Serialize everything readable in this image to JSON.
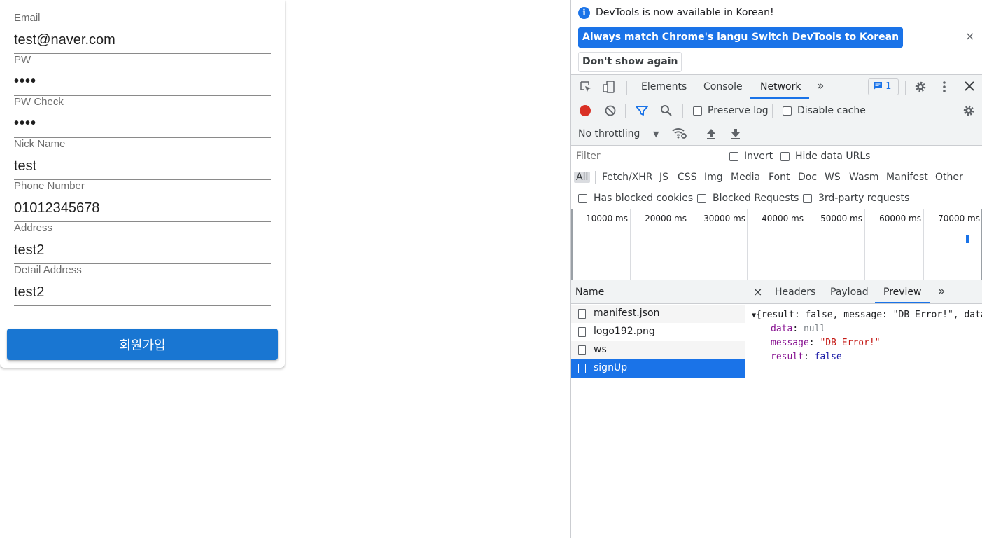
{
  "form": {
    "fields": [
      {
        "label": "Email",
        "value": "test@naver.com"
      },
      {
        "label": "PW",
        "value": "••••"
      },
      {
        "label": "PW Check",
        "value": "••••"
      },
      {
        "label": "Nick Name",
        "value": "test"
      },
      {
        "label": "Phone Number",
        "value": "01012345678"
      },
      {
        "label": "Address",
        "value": "test2"
      },
      {
        "label": "Detail Address",
        "value": "test2"
      }
    ],
    "submit_label": "회원가입"
  },
  "devtools": {
    "infobar": {
      "message": "DevTools is now available in Korean!",
      "btn_match": "Always match Chrome's language",
      "btn_switch": "Switch DevTools to Korean",
      "btn_dont_show": "Don't show again",
      "close": "×"
    },
    "tabs": {
      "elements": "Elements",
      "console": "Console",
      "network": "Network",
      "more": "»",
      "issues_count": "1"
    },
    "toolbar": {
      "preserve_log": "Preserve log",
      "disable_cache": "Disable cache",
      "throttling": "No throttling"
    },
    "filter": {
      "placeholder": "Filter",
      "invert": "Invert",
      "hide_data_urls": "Hide data URLs",
      "types": [
        "All",
        "Fetch/XHR",
        "JS",
        "CSS",
        "Img",
        "Media",
        "Font",
        "Doc",
        "WS",
        "Wasm",
        "Manifest",
        "Other"
      ],
      "has_blocked_cookies": "Has blocked cookies",
      "blocked_requests": "Blocked Requests",
      "third_party": "3rd-party requests"
    },
    "timeline": {
      "ticks": [
        "10000 ms",
        "20000 ms",
        "30000 ms",
        "40000 ms",
        "50000 ms",
        "60000 ms",
        "70000 ms"
      ]
    },
    "requests": {
      "header": "Name",
      "items": [
        "manifest.json",
        "logo192.png",
        "ws",
        "signUp"
      ],
      "selected": "signUp"
    },
    "detail": {
      "close": "×",
      "tabs": [
        "Headers",
        "Payload",
        "Preview"
      ],
      "active_tab": "Preview",
      "more": "»",
      "preview": {
        "summary": "{result: false, message: \"DB Error!\", data: null}",
        "props": [
          {
            "key": "data",
            "value": "null"
          },
          {
            "key": "message",
            "value": "\"DB Error!\""
          },
          {
            "key": "result",
            "value": "false"
          }
        ]
      }
    }
  },
  "colors": {
    "accent": "#1a73e8",
    "submit": "#1976d2",
    "record": "#d93025"
  }
}
